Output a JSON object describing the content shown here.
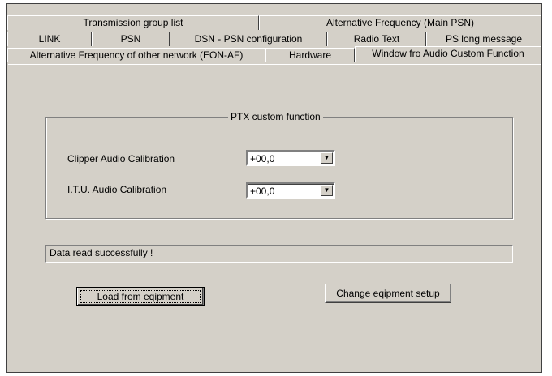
{
  "tabs": {
    "row1": [
      "Transmission group list",
      "Alternative Frequency (Main PSN)"
    ],
    "row2": [
      "LINK",
      "PSN",
      "DSN - PSN configuration",
      "Radio Text",
      "PS long message"
    ],
    "row3": [
      "Alternative Frequency of other network (EON-AF)",
      "Hardware",
      "Window fro Audio Custom Function"
    ]
  },
  "group": {
    "title": "PTX  custom function",
    "clipper_label": "Clipper Audio Calibration",
    "clipper_value": "+00,0",
    "itu_label": "I.T.U.  Audio Calibration",
    "itu_value": "+00,0"
  },
  "status_text": "Data read successfully !",
  "buttons": {
    "load": "Load from eqipment",
    "change": "Change eqipment setup"
  }
}
